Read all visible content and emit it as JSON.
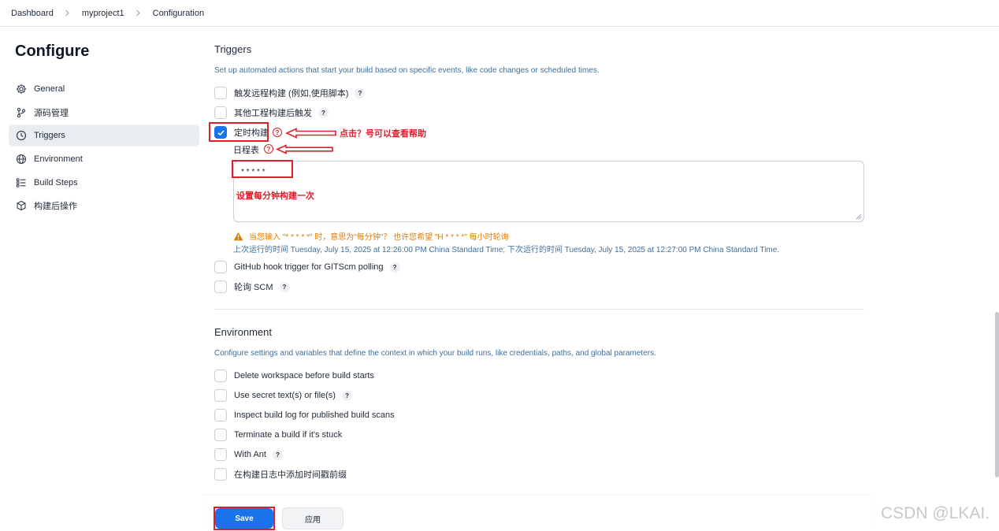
{
  "breadcrumb": {
    "items": [
      "Dashboard",
      "myproject1",
      "Configuration"
    ]
  },
  "sidebar": {
    "title": "Configure",
    "items": [
      {
        "label": "General",
        "icon": "gear-icon"
      },
      {
        "label": "源码管理",
        "icon": "branch-icon"
      },
      {
        "label": "Triggers",
        "icon": "clock-icon",
        "active": true
      },
      {
        "label": "Environment",
        "icon": "globe-icon"
      },
      {
        "label": "Build Steps",
        "icon": "list-icon"
      },
      {
        "label": "构建后操作",
        "icon": "cube-icon"
      }
    ]
  },
  "triggers": {
    "title": "Triggers",
    "description": "Set up automated actions that start your build based on specific events, like code changes or scheduled times.",
    "options": [
      {
        "label": "触发远程构建 (例如,使用脚本)",
        "checked": false
      },
      {
        "label": "其他工程构建后触发",
        "checked": false
      },
      {
        "label": "定时构建",
        "checked": true
      }
    ],
    "schedule": {
      "label": "日程表",
      "value": "* * * * *",
      "warning": "当您输入 \"* * * * *\" 时，意思为\"每分钟\"？ 也许您希望 \"H * * * *\" 每小时轮询",
      "info": "上次运行的时间 Tuesday, July 15, 2025 at 12:26:00 PM China Standard Time; 下次运行的时间 Tuesday, July 15, 2025 at 12:27:00 PM China Standard Time."
    },
    "more_options": [
      {
        "label": "GitHub hook trigger for GITScm polling",
        "checked": false
      },
      {
        "label": "轮询 SCM",
        "checked": false
      }
    ]
  },
  "environment": {
    "title": "Environment",
    "description": "Configure settings and variables that define the context in which your build runs, like credentials, paths, and global parameters.",
    "options": [
      {
        "label": "Delete workspace before build starts",
        "help": false
      },
      {
        "label": "Use secret text(s) or file(s)",
        "help": true
      },
      {
        "label": "Inspect build log for published build scans",
        "help": false
      },
      {
        "label": "Terminate a build if it's stuck",
        "help": false
      },
      {
        "label": "With Ant",
        "help": true
      },
      {
        "label": "在构建日志中添加时间戳前缀",
        "help": false
      }
    ]
  },
  "annotations": {
    "click_help": "点击？号可以查看帮助",
    "every_minute": "设置每分钟构建一次"
  },
  "footer": {
    "save_label": "Save",
    "apply_label": "应用"
  },
  "help_mark": "?",
  "watermark": "CSDN @LKAI.",
  "colors": {
    "accent": "#1a73e8",
    "annotation": "#d9222a",
    "warning": "#e07b00",
    "link_text": "#3f6f9b"
  }
}
